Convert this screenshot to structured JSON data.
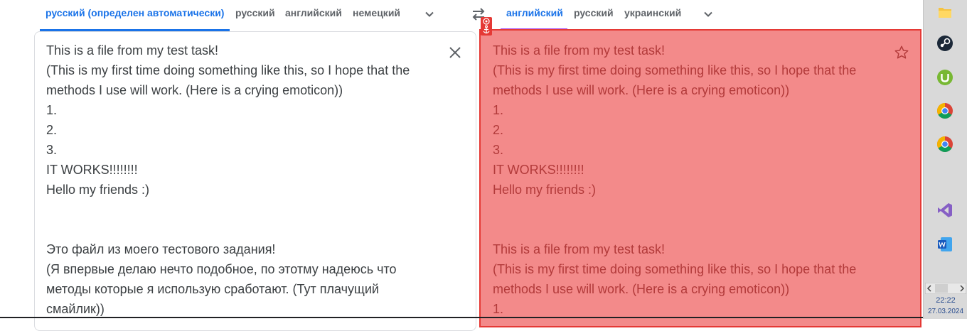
{
  "source": {
    "tabs": [
      {
        "label": "русский (определен автоматически)",
        "active": true
      },
      {
        "label": "русский",
        "active": false
      },
      {
        "label": "английский",
        "active": false
      },
      {
        "label": "немецкий",
        "active": false
      }
    ],
    "text": "This is a file from my test task!\n(This is my first time doing something like this, so I hope that the\nmethods I use will work. (Here is a crying emoticon))\n1.\n2.\n3.\nIT WORKS!!!!!!!!\nHello my friends :)\n\n\nЭто файл из моего тестового задания!\n(Я впервые делаю нечто подобное, по этотму надеюсь что\nметоды которые я использую сработают. (Тут плачущий\nсмайлик))"
  },
  "target": {
    "tabs": [
      {
        "label": "английский",
        "active": true
      },
      {
        "label": "русский",
        "active": false
      },
      {
        "label": "украинский",
        "active": false
      }
    ],
    "text": "This is a file from my test task!\n(This is my first time doing something like this, so I hope that the\nmethods I use will work. (Here is a crying emoticon))\n1.\n2.\n3.\nIT WORKS!!!!!!!!\nHello my friends :)\n\n\nThis is a file from my test task!\n(This is my first time doing something like this, so I hope that the\nmethods I use will work. (Here is a crying emoticon))\n1."
  },
  "icons": {
    "clear": "close-icon",
    "swap": "swap-languages-icon",
    "save": "star-icon",
    "more_source": "chevron-down-icon",
    "more_target": "chevron-down-icon"
  },
  "taskbar": {
    "apps": [
      "folder-icon",
      "steam-icon",
      "utorrent-icon",
      "chrome-icon",
      "chrome-icon",
      "visual-studio-icon",
      "word-icon"
    ],
    "time": "22:22",
    "date": "27.03.2024"
  },
  "colors": {
    "accent": "#1a73e8",
    "tab_text": "#5f6368",
    "target_underline": "#a142f4",
    "overlay_fill": "#f38a8a",
    "overlay_border": "#e53935"
  }
}
